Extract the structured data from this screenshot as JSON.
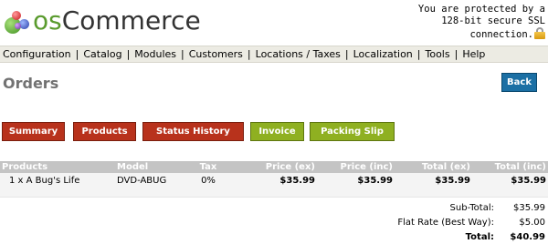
{
  "logo": {
    "prefix": "os",
    "name": "Commerce"
  },
  "ssl": {
    "line1": "You are protected by a",
    "line2": "128-bit secure SSL",
    "line3": "connection."
  },
  "menu": [
    "Configuration",
    "Catalog",
    "Modules",
    "Customers",
    "Locations / Taxes",
    "Localization",
    "Tools",
    "Help"
  ],
  "page": {
    "title": "Orders",
    "back_label": "Back"
  },
  "tabs": {
    "summary": "Summary",
    "products": "Products",
    "status_history": "Status History",
    "invoice": "Invoice",
    "packing_slip": "Packing Slip"
  },
  "table": {
    "headers": {
      "products": "Products",
      "model": "Model",
      "tax": "Tax",
      "price_ex": "Price (ex)",
      "price_inc": "Price (inc)",
      "total_ex": "Total (ex)",
      "total_inc": "Total (inc)"
    },
    "rows": [
      {
        "product": "1 x A Bug's Life",
        "model": "DVD-ABUG",
        "tax": "0%",
        "price_ex": "$35.99",
        "price_inc": "$35.99",
        "total_ex": "$35.99",
        "total_inc": "$35.99"
      }
    ]
  },
  "totals": {
    "subtotal_label": "Sub-Total:",
    "subtotal_value": "$35.99",
    "shipping_label": "Flat Rate (Best Way):",
    "shipping_value": "$5.00",
    "total_label": "Total:",
    "total_value": "$40.99"
  },
  "colors": {
    "tab_red": "#b8321c",
    "tab_green": "#8fb021",
    "back_blue": "#1b6fa4",
    "table_header": "#c4c4c4"
  }
}
